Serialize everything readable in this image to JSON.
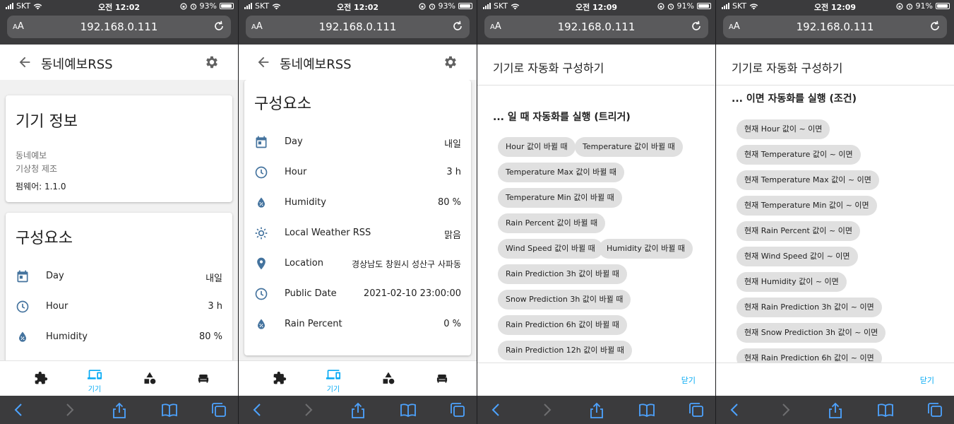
{
  "colors": {
    "accent": "#03a9f4",
    "icon": "#44739e",
    "chip": "#e0e0e0",
    "chrome": "#3b3b3d"
  },
  "screens": [
    {
      "status": {
        "carrier": "SKT",
        "time": "오전 12:02",
        "battery": "93%",
        "battery_level": 0.93
      },
      "address": {
        "aa": "AA",
        "url": "192.168.0.111"
      },
      "app_title": "동네예보RSS",
      "device_card": {
        "title": "기기 정보",
        "model": "동네예보",
        "manufacturer": "기상청 제조",
        "firmware": "펌웨어: 1.1.0"
      },
      "entities_card": {
        "title": "구성요소",
        "rows": [
          {
            "icon": "calendar-icon",
            "name": "Day",
            "value": "내일"
          },
          {
            "icon": "clock-icon",
            "name": "Hour",
            "value": "3 h"
          },
          {
            "icon": "water-percent-icon",
            "name": "Humidity",
            "value": "80 %"
          }
        ]
      },
      "nav": {
        "devices_label": "기기"
      }
    },
    {
      "status": {
        "carrier": "SKT",
        "time": "오전 12:02",
        "battery": "93%",
        "battery_level": 0.93
      },
      "address": {
        "aa": "AA",
        "url": "192.168.0.111"
      },
      "app_title": "동네예보RSS",
      "entities_card": {
        "title": "구성요소",
        "rows": [
          {
            "icon": "calendar-icon",
            "name": "Day",
            "value": "내일"
          },
          {
            "icon": "clock-icon",
            "name": "Hour",
            "value": "3 h"
          },
          {
            "icon": "water-percent-icon",
            "name": "Humidity",
            "value": "80 %"
          },
          {
            "icon": "weather-sunny-icon",
            "name": "Local Weather RSS",
            "value": "맑음"
          },
          {
            "icon": "map-marker-icon",
            "name": "Location",
            "value": "경상남도 창원시 성산구 사파동"
          },
          {
            "icon": "clock-icon",
            "name": "Public Date",
            "value": "2021-02-10 23:00:00"
          },
          {
            "icon": "water-percent-icon",
            "name": "Rain Percent",
            "value": "0 %"
          }
        ]
      },
      "nav": {
        "devices_label": "기기"
      }
    },
    {
      "status": {
        "carrier": "SKT",
        "time": "오전 12:09",
        "battery": "91%",
        "battery_level": 0.91
      },
      "address": {
        "aa": "AA",
        "url": "192.168.0.111"
      },
      "dialog": {
        "title": "기기로 자동화 구성하기",
        "section": "... 일 때 자동화를 실행 (트리거)",
        "chips": [
          "Hour 값이 바뀔 때",
          "Temperature 값이 바뀔 때",
          "Temperature Max 값이 바뀔 때",
          "Temperature Min 값이 바뀔 때",
          "Rain Percent 값이 바뀔 때",
          "Wind Speed 값이 바뀔 때",
          "Humidity 값이 바뀔 때",
          "Rain Prediction 3h 값이 바뀔 때",
          "Snow Prediction 3h 값이 바뀔 때",
          "Rain Prediction 6h 값이 바뀔 때",
          "Rain Prediction 12h 값이 바뀔 때"
        ],
        "close": "닫기"
      }
    },
    {
      "status": {
        "carrier": "SKT",
        "time": "오전 12:09",
        "battery": "91%",
        "battery_level": 0.91
      },
      "address": {
        "aa": "AA",
        "url": "192.168.0.111"
      },
      "dialog": {
        "title": "기기로 자동화 구성하기",
        "section": "... 이면 자동화를 실행 (조건)",
        "chips": [
          "현재 Hour 값이 ~ 이면",
          "현재 Temperature 값이 ~ 이면",
          "현재 Temperature Max 값이 ~ 이면",
          "현재 Temperature Min 값이 ~ 이면",
          "현재 Rain Percent 값이 ~ 이면",
          "현재 Wind Speed 값이 ~ 이면",
          "현재 Humidity 값이 ~ 이면",
          "현재 Rain Prediction 3h 값이 ~ 이면",
          "현재 Snow Prediction 3h 값이 ~ 이면",
          "현재 Rain Prediction 6h 값이 ~ 이면"
        ],
        "close": "닫기"
      }
    }
  ]
}
